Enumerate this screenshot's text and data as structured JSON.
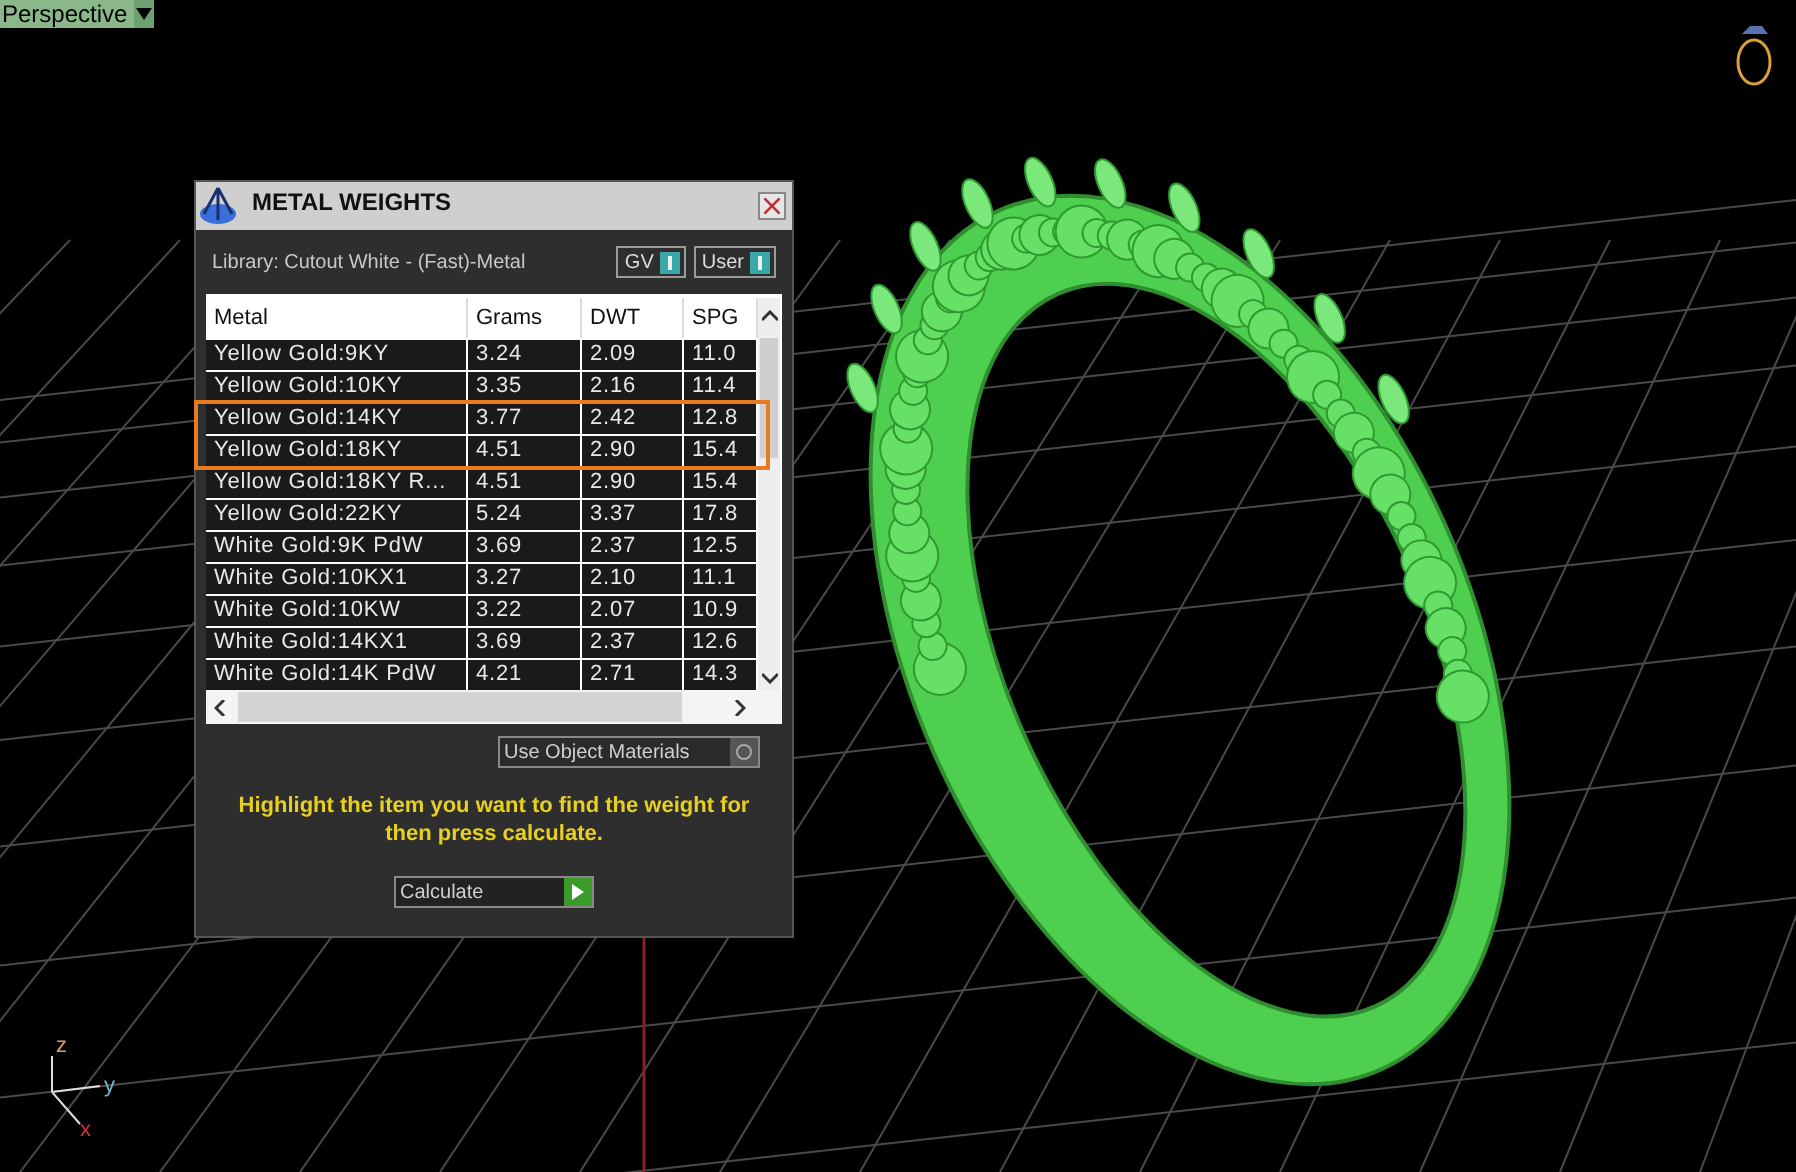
{
  "viewport": {
    "title": "Perspective"
  },
  "axes": [
    "z",
    "y",
    "x"
  ],
  "dialog": {
    "title": "METAL WEIGHTS",
    "library": "Library: Cutout White - (Fast)-Metal",
    "toggles": [
      {
        "label": "GV",
        "on": true
      },
      {
        "label": "User",
        "on": true
      }
    ],
    "columns": [
      "Metal",
      "Grams",
      "DWT",
      "SPG"
    ],
    "rows": [
      {
        "cells": [
          "Yellow Gold:9KY",
          "3.24",
          "2.09",
          "11.0"
        ],
        "marked": false
      },
      {
        "cells": [
          "Yellow Gold:10KY",
          "3.35",
          "2.16",
          "11.4"
        ],
        "marked": false
      },
      {
        "cells": [
          "Yellow Gold:14KY",
          "3.77",
          "2.42",
          "12.8"
        ],
        "marked": true
      },
      {
        "cells": [
          "Yellow Gold:18KY",
          "4.51",
          "2.90",
          "15.4"
        ],
        "marked": true
      },
      {
        "cells": [
          "Yellow Gold:18KY R...",
          "4.51",
          "2.90",
          "15.4"
        ],
        "marked": false
      },
      {
        "cells": [
          "Yellow Gold:22KY",
          "5.24",
          "3.37",
          "17.8"
        ],
        "marked": false
      },
      {
        "cells": [
          "White Gold:9K PdW",
          "3.69",
          "2.37",
          "12.5"
        ],
        "marked": false
      },
      {
        "cells": [
          "White Gold:10KX1",
          "3.27",
          "2.10",
          "11.1"
        ],
        "marked": false
      },
      {
        "cells": [
          "White Gold:10KW",
          "3.22",
          "2.07",
          "10.9"
        ],
        "marked": false
      },
      {
        "cells": [
          "White Gold:14KX1",
          "3.69",
          "2.37",
          "12.6"
        ],
        "marked": false
      },
      {
        "cells": [
          "White Gold:14K PdW",
          "4.21",
          "2.71",
          "14.3"
        ],
        "marked": false
      }
    ],
    "materials_dropdown": "Use Object Materials",
    "hint": "Highlight the item you want to find the weight for then press calculate.",
    "button": "Calculate"
  }
}
